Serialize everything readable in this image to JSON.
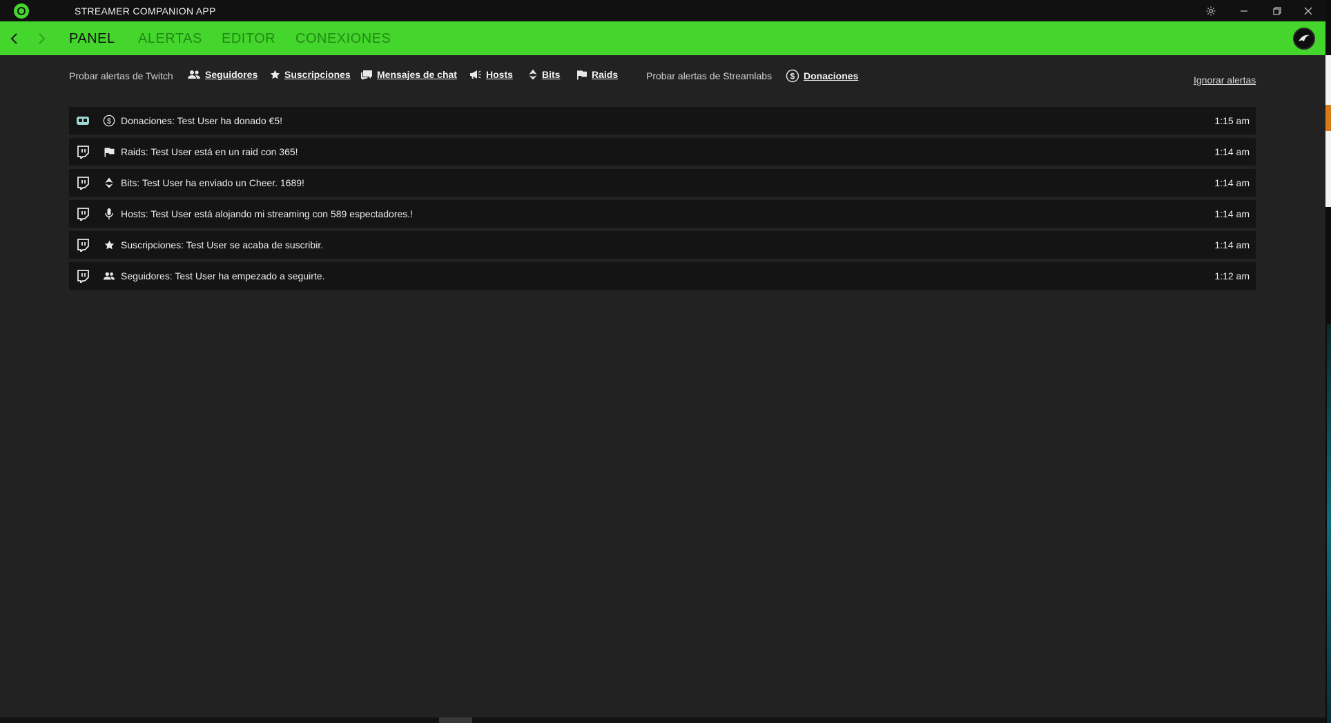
{
  "app": {
    "title": "STREAMER COMPANION APP"
  },
  "nav": {
    "tabs": [
      {
        "label": "PANEL",
        "active": true
      },
      {
        "label": "ALERTAS",
        "active": false
      },
      {
        "label": "EDITOR",
        "active": false
      },
      {
        "label": "CONEXIONES",
        "active": false
      }
    ]
  },
  "toolbar": {
    "twitch_label": "Probar alertas de Twitch",
    "streamlabs_label": "Probar alertas de Streamlabs",
    "links": {
      "followers": "Seguidores",
      "subscriptions": "Suscripciones",
      "chat": "Mensajes de chat",
      "hosts": "Hosts",
      "bits": "Bits",
      "raids": "Raids",
      "donations": "Donaciones"
    },
    "ignore": "Ignorar alertas"
  },
  "alerts": [
    {
      "source": "streamlabs",
      "icon": "dollar-icon",
      "text": "Donaciones: Test User ha donado €5!",
      "time": "1:15 am"
    },
    {
      "source": "twitch",
      "icon": "flag-icon",
      "text": "Raids: Test User está en un raid con 365!",
      "time": "1:14 am"
    },
    {
      "source": "twitch",
      "icon": "bits-icon",
      "text": "Bits: Test User ha enviado un Cheer. 1689!",
      "time": "1:14 am"
    },
    {
      "source": "twitch",
      "icon": "microphone-icon",
      "text": "Hosts: Test User está alojando mi streaming con 589 espectadores.!",
      "time": "1:14 am"
    },
    {
      "source": "twitch",
      "icon": "star-icon",
      "text": "Suscripciones: Test User se acaba de suscribir.",
      "time": "1:14 am"
    },
    {
      "source": "twitch",
      "icon": "people-icon",
      "text": "Seguidores: Test User ha empezado a seguirte.",
      "time": "1:12 am"
    }
  ],
  "colors": {
    "accent": "#44d62c",
    "background": "#222222",
    "row": "#141414",
    "titlebar": "#111111"
  }
}
